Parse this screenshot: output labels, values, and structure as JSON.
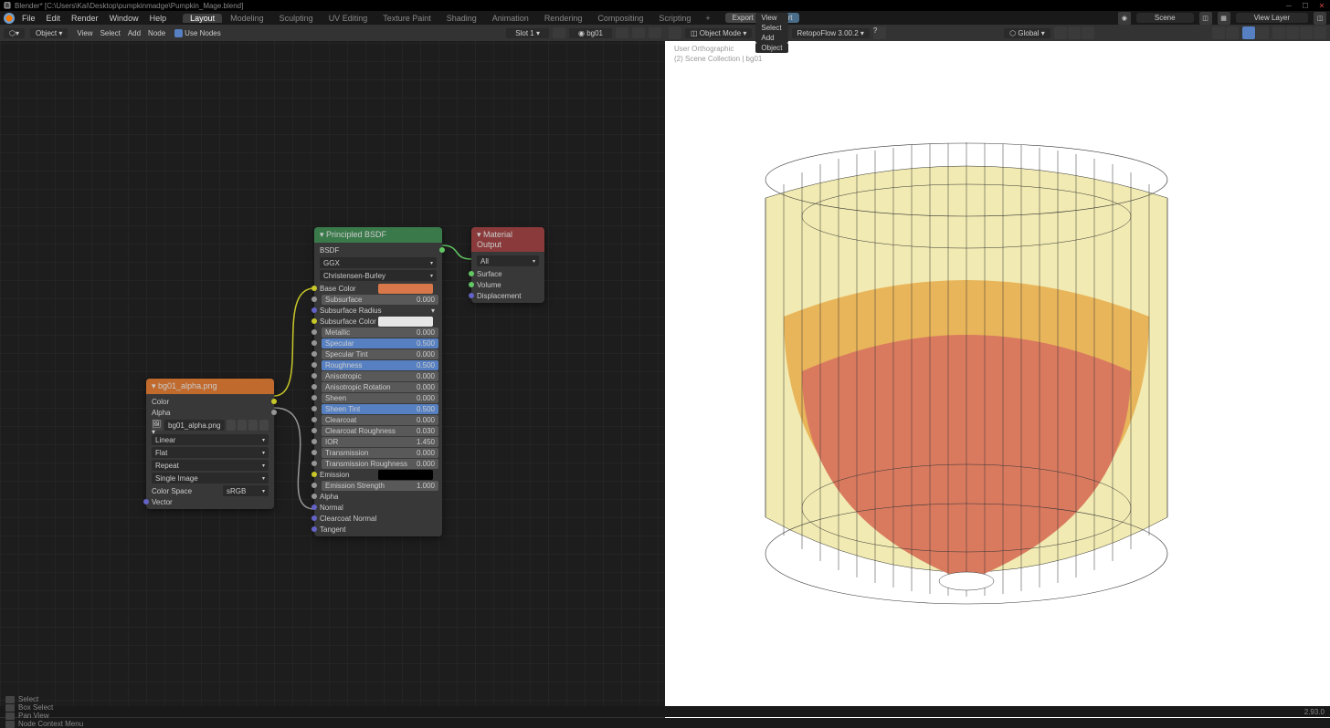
{
  "title_bar": {
    "text": "Blender* [C:\\Users\\Kai\\Desktop\\pumpkinmadge\\Pumpkin_Mage.blend]"
  },
  "menu": {
    "items": [
      "File",
      "Edit",
      "Render",
      "Window",
      "Help"
    ],
    "tabs": [
      "Layout",
      "Modeling",
      "Sculpting",
      "UV Editing",
      "Texture Paint",
      "Shading",
      "Animation",
      "Rendering",
      "Compositing",
      "Scripting"
    ],
    "active_tab": "Layout",
    "export": "Export",
    "import": "Import",
    "scene": "Scene",
    "view_layer": "View Layer"
  },
  "node_hdr": {
    "object": "Object",
    "items": [
      "View",
      "Select",
      "Add",
      "Node"
    ],
    "use_nodes": "Use Nodes",
    "slot": "Slot 1",
    "material": "bg01"
  },
  "image_node": {
    "title": "bg01_alpha.png",
    "out_color": "Color",
    "out_alpha": "Alpha",
    "filename": "bg01_alpha.png",
    "interp": "Linear",
    "proj": "Flat",
    "ext": "Repeat",
    "source": "Single Image",
    "color_space_lbl": "Color Space",
    "color_space": "sRGB",
    "vector": "Vector"
  },
  "bsdf": {
    "title": "Principled BSDF",
    "out": "BSDF",
    "dist": "GGX",
    "sss_method": "Christensen-Burley",
    "params": [
      {
        "name": "Base Color",
        "type": "color",
        "color": "#d8784a",
        "sock": "yellow"
      },
      {
        "name": "Subsurface",
        "val": "0.000",
        "sock": "grey"
      },
      {
        "name": "Subsurface Radius",
        "type": "drop",
        "sock": "purple"
      },
      {
        "name": "Subsurface Color",
        "type": "color",
        "color": "#e6e6e6",
        "sock": "yellow"
      },
      {
        "name": "Metallic",
        "val": "0.000",
        "sock": "grey"
      },
      {
        "name": "Specular",
        "val": "0.500",
        "sock": "grey",
        "hl": true
      },
      {
        "name": "Specular Tint",
        "val": "0.000",
        "sock": "grey"
      },
      {
        "name": "Roughness",
        "val": "0.500",
        "sock": "grey",
        "hl": true
      },
      {
        "name": "Anisotropic",
        "val": "0.000",
        "sock": "grey"
      },
      {
        "name": "Anisotropic Rotation",
        "val": "0.000",
        "sock": "grey"
      },
      {
        "name": "Sheen",
        "val": "0.000",
        "sock": "grey"
      },
      {
        "name": "Sheen Tint",
        "val": "0.500",
        "sock": "grey",
        "hl": true
      },
      {
        "name": "Clearcoat",
        "val": "0.000",
        "sock": "grey"
      },
      {
        "name": "Clearcoat Roughness",
        "val": "0.030",
        "sock": "grey"
      },
      {
        "name": "IOR",
        "val": "1.450",
        "sock": "grey"
      },
      {
        "name": "Transmission",
        "val": "0.000",
        "sock": "grey"
      },
      {
        "name": "Transmission Roughness",
        "val": "0.000",
        "sock": "grey"
      },
      {
        "name": "Emission",
        "type": "color",
        "color": "#000000",
        "sock": "yellow"
      },
      {
        "name": "Emission Strength",
        "val": "1.000",
        "sock": "grey"
      },
      {
        "name": "Alpha",
        "type": "none",
        "sock": "grey"
      },
      {
        "name": "Normal",
        "type": "none",
        "sock": "purple"
      },
      {
        "name": "Clearcoat Normal",
        "type": "none",
        "sock": "purple"
      },
      {
        "name": "Tangent",
        "type": "none",
        "sock": "purple"
      }
    ]
  },
  "mat_out": {
    "title": "Material Output",
    "target": "All",
    "ins": [
      "Surface",
      "Volume",
      "Displacement"
    ]
  },
  "vp_hdr": {
    "mode": "Object Mode",
    "items": [
      "View",
      "Select",
      "Add",
      "Object"
    ],
    "retopo": "RetopoFlow 3.00.2",
    "orient": "Global"
  },
  "vp_info": {
    "persp": "User Orthographic",
    "coll": "(2) Scene Collection | bg01"
  },
  "bottom": {
    "object": "bg01"
  },
  "status": {
    "items": [
      "Select",
      "Box Select",
      "Pan View",
      "Node Context Menu"
    ],
    "version": "2.93.0"
  }
}
